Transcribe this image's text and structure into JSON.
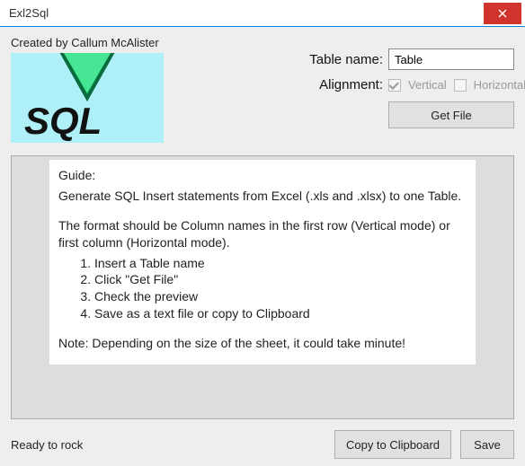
{
  "window": {
    "title": "Exl2Sql"
  },
  "author": "Created by Callum McAlister",
  "logo_text": "SQL",
  "form": {
    "table_label": "Table name:",
    "table_value": "Table",
    "alignment_label": "Alignment:",
    "vertical_label": "Vertical",
    "horizontal_label": "Horizontal",
    "vertical_checked": true,
    "horizontal_checked": false,
    "get_file_label": "Get File"
  },
  "guide": {
    "title": "Guide:",
    "intro": "Generate SQL Insert statements from Excel (.xls and .xlsx) to one Table.",
    "format": "The format should be Column names in the first row (Vertical mode) or first column (Horizontal mode).",
    "steps": [
      "Insert a Table name",
      "Click \"Get File\"",
      "Check the preview",
      "Save as a text file or copy to Clipboard"
    ],
    "note": "Note: Depending on the size of the sheet, it could take minute!"
  },
  "status": "Ready to rock",
  "buttons": {
    "copy": "Copy to Clipboard",
    "save": "Save"
  }
}
